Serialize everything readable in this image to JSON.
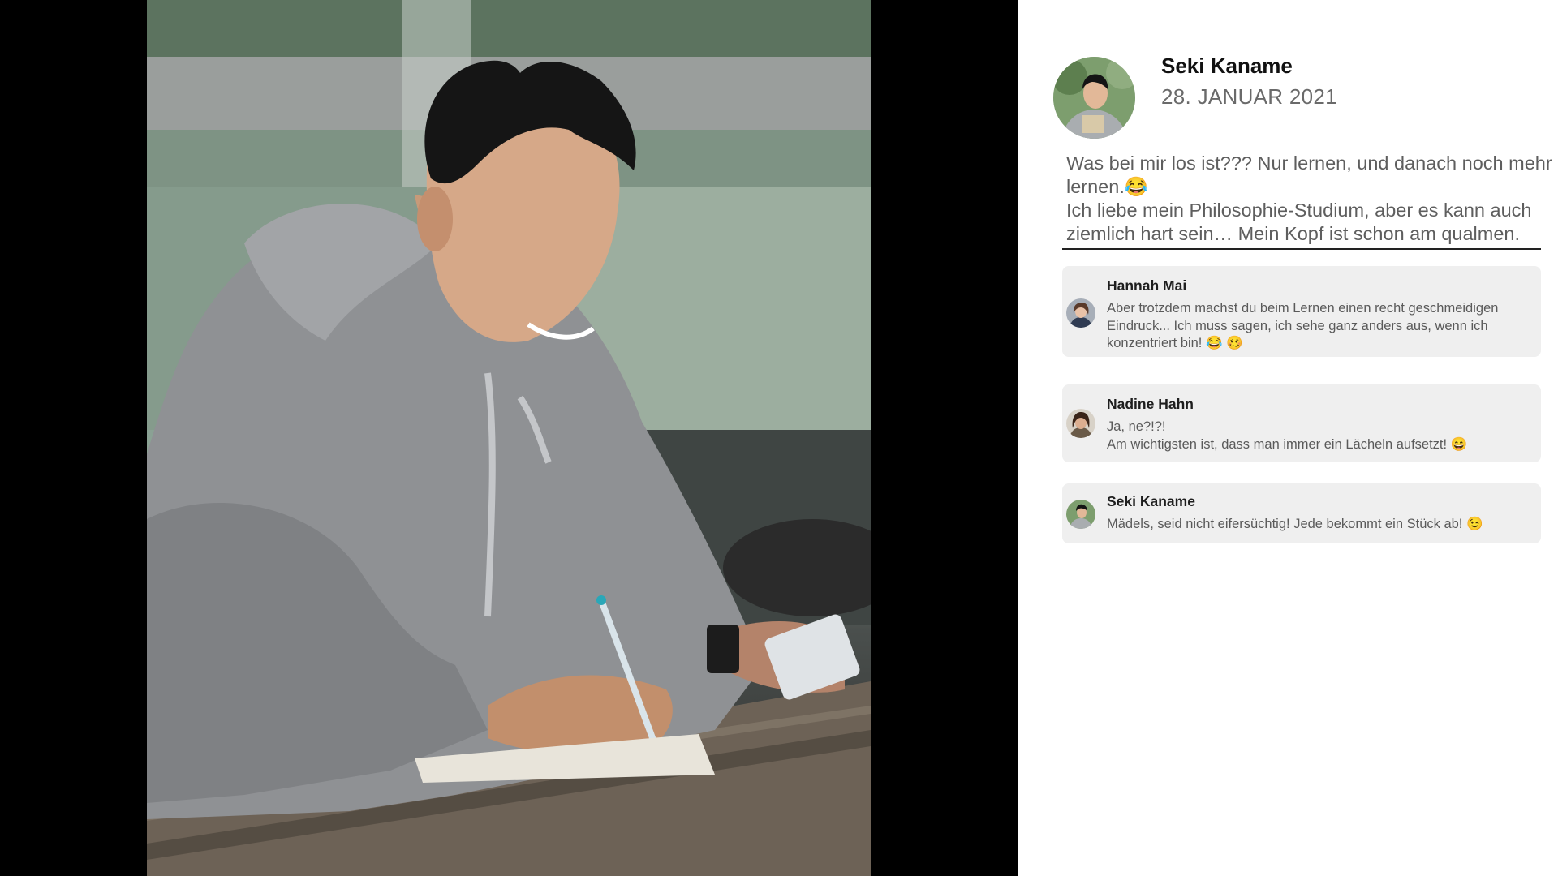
{
  "post": {
    "author": "Seki Kaname",
    "date": "28. JANUAR 2021",
    "text_lines": [
      "Was bei mir los ist??? Nur lernen, und danach noch mehr lernen.😂",
      "Ich liebe mein Philosophie-Studium, aber es kann auch ziemlich hart sein… Mein Kopf ist schon am qualmen."
    ],
    "photo_alt": "student-writing-photo"
  },
  "comments": [
    {
      "author": "Hannah Mai",
      "lines": [
        "Aber trotzdem machst du beim Lernen einen recht geschmeidigen Eindruck... Ich muss sagen, ich sehe ganz anders aus, wenn ich konzentriert bin! 😂 🥴"
      ]
    },
    {
      "author": "Nadine Hahn",
      "lines": [
        "Ja, ne?!?!",
        "Am wichtigsten ist, dass man immer ein Lächeln aufsetzt! 😄"
      ]
    },
    {
      "author": "Seki Kaname",
      "lines": [
        "Mädels, seid nicht eifersüchtig! Jede bekommt ein Stück ab! 😉"
      ]
    }
  ],
  "colors": {
    "background_left": "#000000",
    "comment_bg": "#efefef",
    "text_primary": "#111111",
    "text_secondary": "#5e5e5e"
  }
}
